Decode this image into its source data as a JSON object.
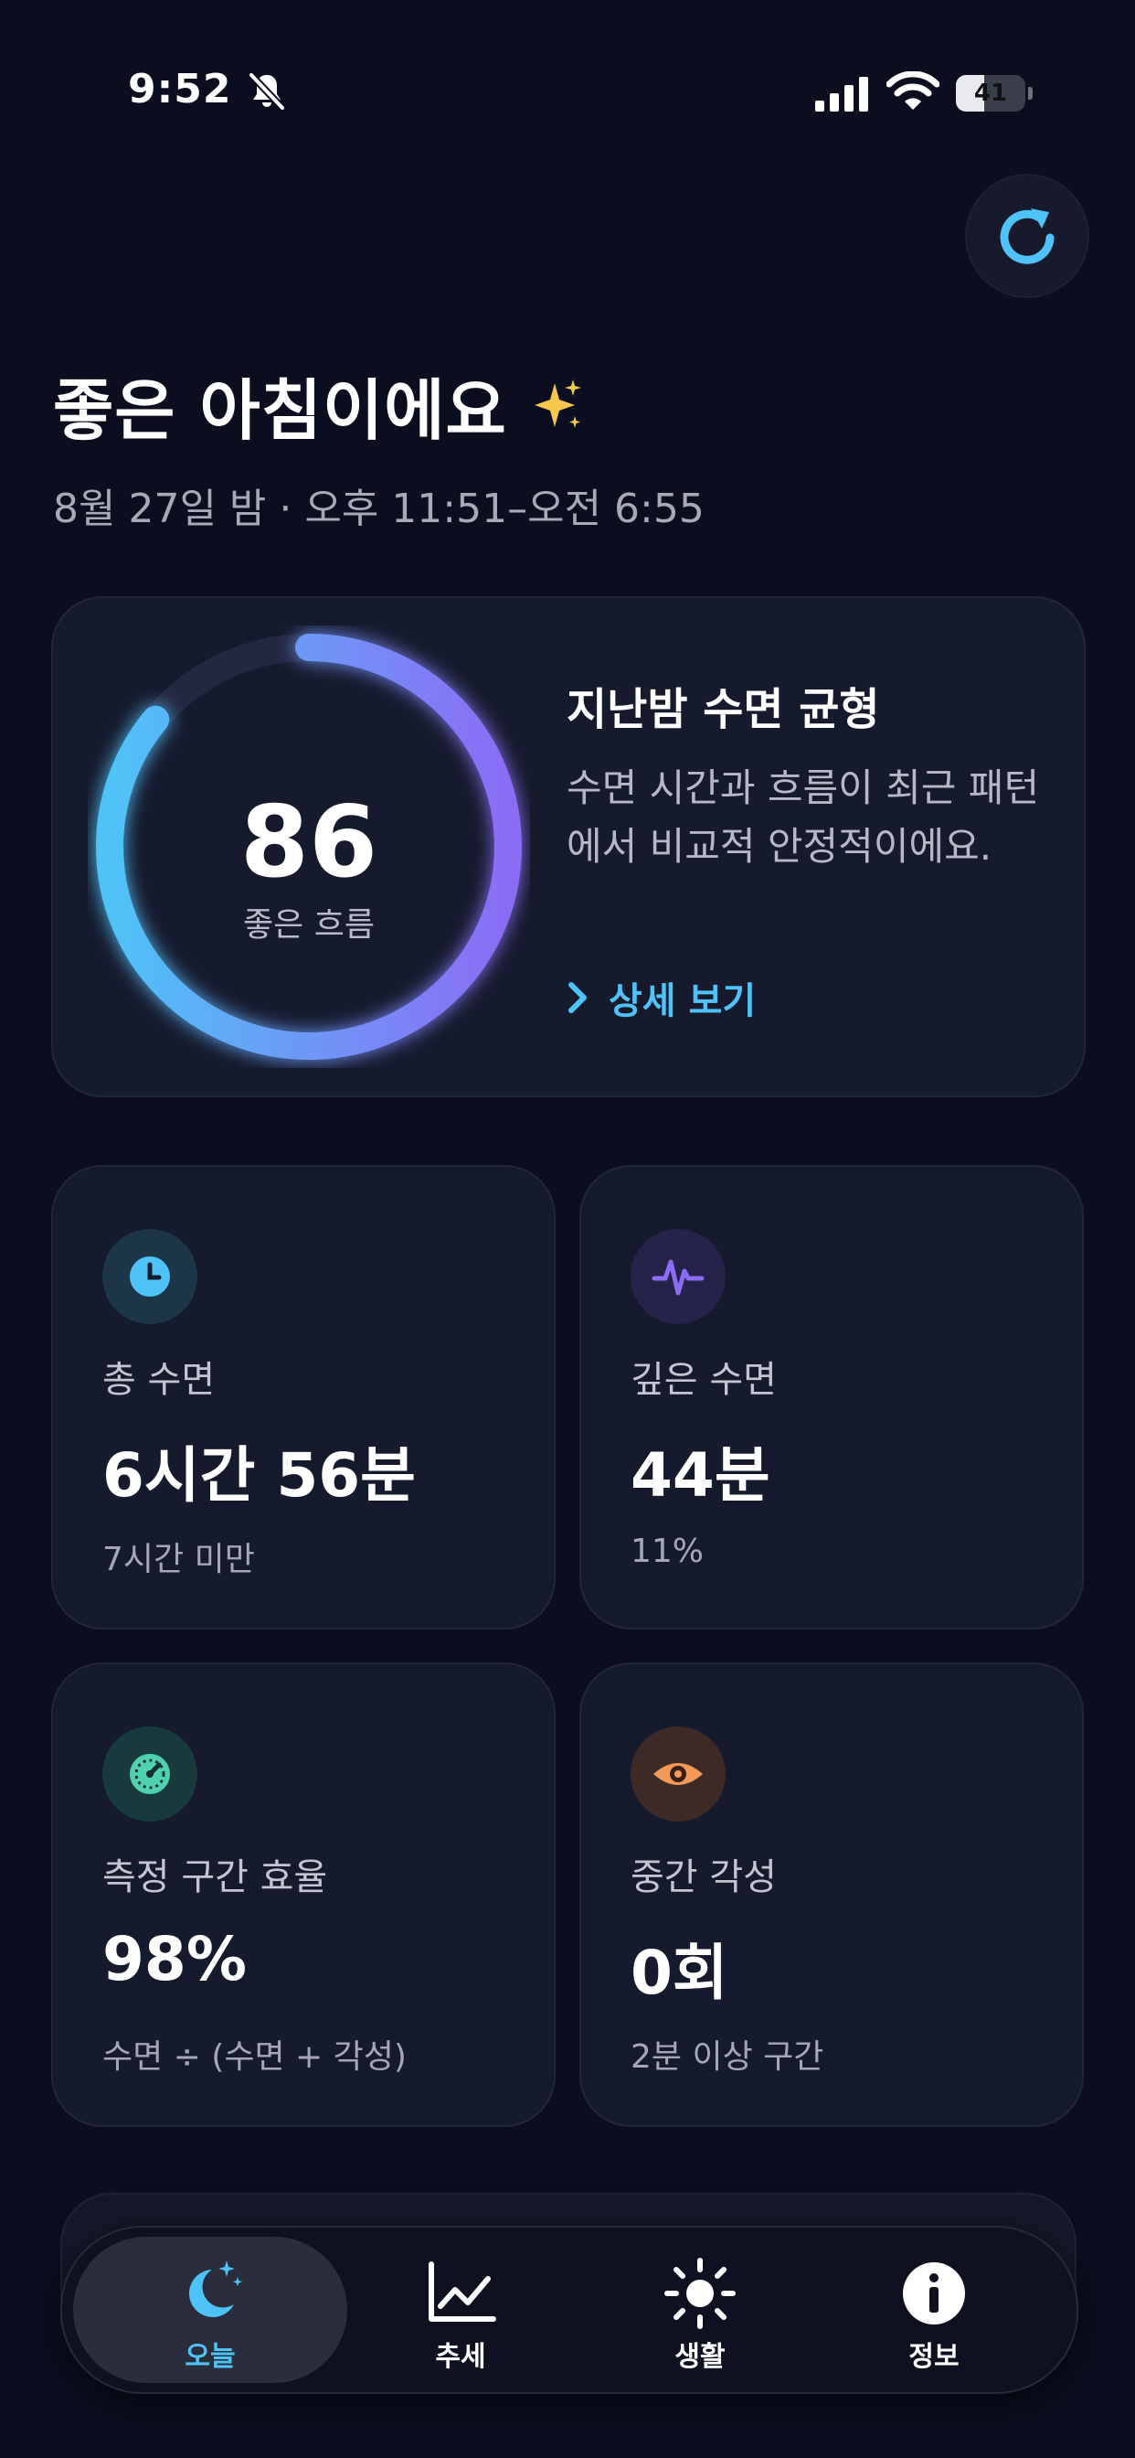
{
  "status_bar": {
    "time": "9:52",
    "battery": "41",
    "battery_level": 0.41
  },
  "header": {
    "greeting": "좋은 아침이에요",
    "date_range": "8월 27일 밤 · 오후 11:51–오전 6:55"
  },
  "score": {
    "value": "86",
    "label": "좋은 흐름",
    "progress": 0.86,
    "title": "지난밤 수면 균형",
    "description": "수면 시간과 흐름이 최근 패턴에서 비교적 안정적이에요.",
    "link": "상세 보기"
  },
  "metrics": [
    {
      "label": "총 수면",
      "value": "6시간 56분",
      "sub": "7시간 미만",
      "icon": "clock-icon",
      "color": "#4fc3f7"
    },
    {
      "label": "깊은 수면",
      "value": "44분",
      "sub": "11%",
      "icon": "pulse-icon",
      "color": "#8b6cf5"
    },
    {
      "label": "측정 구간 효율",
      "value": "98%",
      "sub": "수면 ÷ (수면 + 각성)",
      "icon": "gauge-icon",
      "color": "#4fd1b0"
    },
    {
      "label": "중간 각성",
      "value": "0회",
      "sub": "2분 이상 구간",
      "icon": "eye-icon",
      "color": "#f39a5b"
    }
  ],
  "tabs": [
    {
      "label": "오늘",
      "icon": "moon-stars-icon",
      "active": true
    },
    {
      "label": "추세",
      "icon": "chart-line-icon",
      "active": false
    },
    {
      "label": "생활",
      "icon": "sun-icon",
      "active": false
    },
    {
      "label": "정보",
      "icon": "info-icon",
      "active": false
    }
  ],
  "colors": {
    "accent": "#4fc3f7",
    "ring_start": "#4fc3f7",
    "ring_end": "#8b6cf5",
    "background": "#0b0e1f"
  }
}
